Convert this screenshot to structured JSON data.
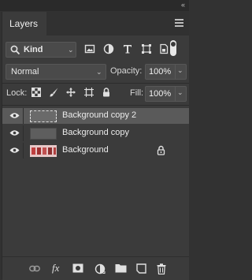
{
  "panel": {
    "tab_label": "Layers",
    "menu_icon": "hamburger-menu-icon"
  },
  "filter": {
    "kind_label": "Kind",
    "icons": [
      "pixel-layer-filter-icon",
      "adjustment-layer-filter-icon",
      "type-layer-filter-icon",
      "shape-layer-filter-icon",
      "smart-object-filter-icon"
    ],
    "toggle_state": "on"
  },
  "blend": {
    "mode": "Normal",
    "opacity_label": "Opacity:",
    "opacity_value": "100%"
  },
  "lock": {
    "label": "Lock:",
    "icons": [
      "lock-transparent-pixels-icon",
      "lock-image-pixels-icon",
      "lock-position-icon",
      "lock-artboard-icon",
      "lock-all-icon"
    ],
    "fill_label": "Fill:",
    "fill_value": "100%"
  },
  "layers": [
    {
      "name": "Background copy 2",
      "selected": true,
      "locked": false,
      "thumb_color": "#6a6a6a"
    },
    {
      "name": "Background copy",
      "selected": false,
      "locked": false,
      "thumb_color": "#5e5e5e"
    },
    {
      "name": "Background",
      "selected": false,
      "locked": true,
      "thumb_color": "#e8c8c8"
    }
  ],
  "bottom_icons": [
    "link-layers-icon",
    "fx-layer-style-icon",
    "add-mask-icon",
    "new-fill-adjustment-icon",
    "new-group-icon",
    "new-layer-icon",
    "delete-layer-icon"
  ],
  "bottom_fx_label": "fx",
  "colors": {
    "panel_bg": "#3b3b3b",
    "selected_row": "#5a5a5a",
    "text": "#ececec"
  }
}
